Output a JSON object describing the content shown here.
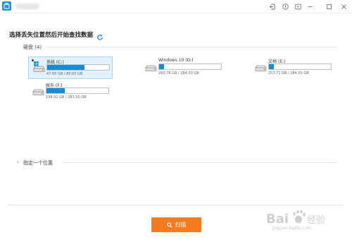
{
  "window": {
    "controls": [
      "back-icon",
      "info-icon",
      "cast-icon",
      "minimize-icon",
      "maximize-icon",
      "close-icon"
    ]
  },
  "heading": "选择丢失位置然后开始查找数据",
  "hard_disk": {
    "label": "硬盘 (4)"
  },
  "drives": [
    {
      "name": "系统 (C:)",
      "size": "47.65 GB / 80.00 GB",
      "fraction": 0.6,
      "selected": true
    },
    {
      "name": "Windows 10 (D:)",
      "size": "260.76 GB / 284.00 GB",
      "fraction": 0.08,
      "selected": false
    },
    {
      "name": "文档 (E:)",
      "size": "253.71 GB / 284.00 GB",
      "fraction": 0.08,
      "selected": false
    },
    {
      "name": "娱乐 (F:)",
      "size": "198.91 GB / 283.50 GB",
      "fraction": 0.3,
      "selected": false
    }
  ],
  "specify_location": "指定一个位置",
  "scan_button": "扫描",
  "watermark": {
    "text": "jingyan.baidu.com"
  },
  "colors": {
    "accent": "#1a8ad6",
    "scan": "#f47b20",
    "selected_bg": "#e2f1fb"
  }
}
